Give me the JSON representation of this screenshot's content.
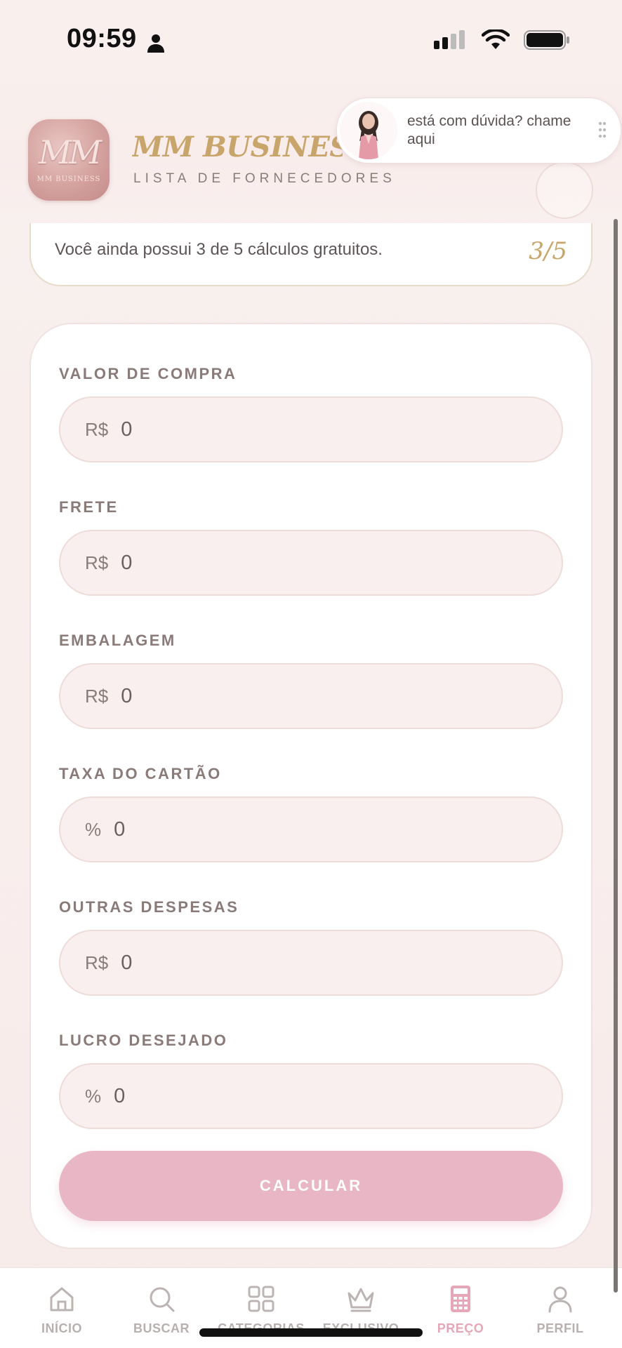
{
  "status_bar": {
    "time": "09:59"
  },
  "header": {
    "logo_text": "MM",
    "logo_subtext": "MM BUSINESS",
    "brand_title": "MM BUSINESS CL",
    "brand_subtitle": "LISTA DE FORNECEDORES"
  },
  "chat": {
    "text": "está com dúvida? chame aqui"
  },
  "free_banner": {
    "text": "Você ainda possui 3 de 5 cálculos gratuitos.",
    "count": "3/5"
  },
  "form": {
    "fields": [
      {
        "label": "VALOR DE COMPRA",
        "prefix": "R$",
        "value": "0"
      },
      {
        "label": "FRETE",
        "prefix": "R$",
        "value": "0"
      },
      {
        "label": "EMBALAGEM",
        "prefix": "R$",
        "value": "0"
      },
      {
        "label": "TAXA DO CARTÃO",
        "prefix": "%",
        "value": "0"
      },
      {
        "label": "OUTRAS DESPESAS",
        "prefix": "R$",
        "value": "0"
      },
      {
        "label": "LUCRO DESEJADO",
        "prefix": "%",
        "value": "0"
      }
    ],
    "calc_button": "CALCULAR"
  },
  "nav": {
    "items": [
      {
        "label": "INÍCIO",
        "icon": "home-icon"
      },
      {
        "label": "BUSCAR",
        "icon": "search-icon"
      },
      {
        "label": "CATEGORIAS",
        "icon": "grid-icon"
      },
      {
        "label": "EXCLUSIVO",
        "icon": "crown-icon"
      },
      {
        "label": "PREÇO",
        "icon": "calculator-icon",
        "active": true
      },
      {
        "label": "PERFIL",
        "icon": "user-icon"
      }
    ]
  },
  "colors": {
    "accent_gold": "#c8a56a",
    "accent_pink": "#e8b6c4",
    "active_nav": "#e5a7b8"
  }
}
